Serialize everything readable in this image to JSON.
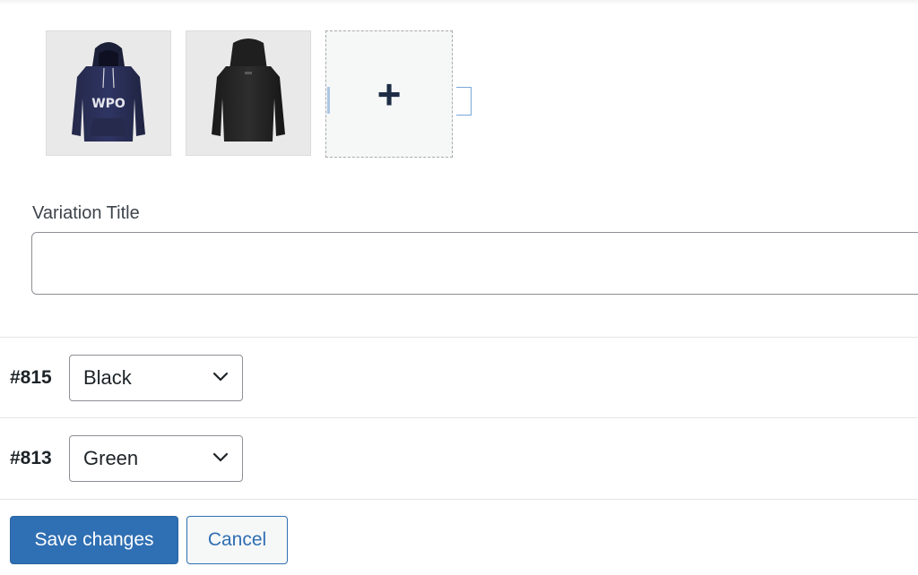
{
  "gallery": {
    "images": [
      {
        "name": "hoodie-front-navy",
        "alt": "WPO hoodie front",
        "print": "WPO"
      },
      {
        "name": "hoodie-back-black",
        "alt": "Hoodie back"
      }
    ],
    "add_symbol": "+"
  },
  "variation_title": {
    "label": "Variation Title",
    "value": "",
    "placeholder": ""
  },
  "variations": [
    {
      "id": "#815",
      "selected": "Black"
    },
    {
      "id": "#813",
      "selected": "Green"
    }
  ],
  "actions": {
    "save_label": "Save changes",
    "cancel_label": "Cancel"
  },
  "colors": {
    "primary": "#2f6fb3",
    "hoodie_navy": "#2b2f57",
    "hoodie_black": "#222222"
  }
}
